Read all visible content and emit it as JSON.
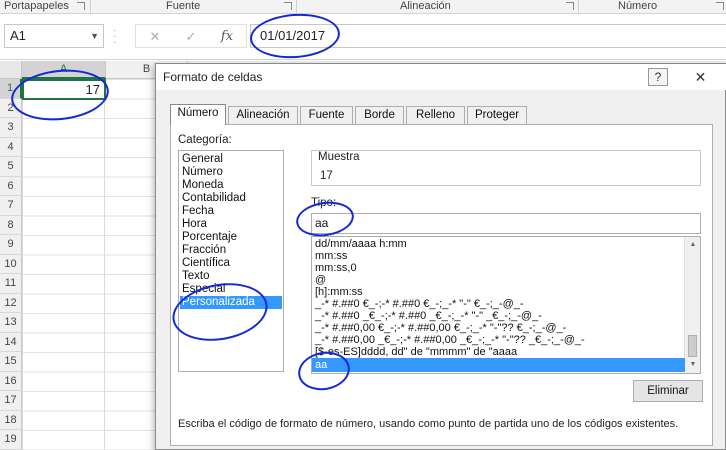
{
  "ribbon": {
    "groups": [
      "Portapapeles",
      "Fuente",
      "Alineación",
      "Número"
    ]
  },
  "formula_bar": {
    "name_box": "A1",
    "value": "01/01/2017",
    "fx_label": "fx"
  },
  "sheet": {
    "columns": [
      "A",
      "B"
    ],
    "rows": [
      "1",
      "2",
      "3",
      "4",
      "5",
      "6",
      "7",
      "8",
      "9",
      "10",
      "11",
      "12",
      "13",
      "14",
      "15",
      "16",
      "17",
      "18",
      "19"
    ],
    "active_cell_value": "17"
  },
  "dialog": {
    "title": "Formato de celdas",
    "help_label": "?",
    "tabs": [
      "Número",
      "Alineación",
      "Fuente",
      "Borde",
      "Relleno",
      "Proteger"
    ],
    "category_label": "Categoría:",
    "categories": [
      "General",
      "Número",
      "Moneda",
      "Contabilidad",
      "Fecha",
      "Hora",
      "Porcentaje",
      "Fracción",
      "Científica",
      "Texto",
      "Especial",
      "Personalizada"
    ],
    "sample_label": "Muestra",
    "sample_value": "17",
    "type_label": "Tipo:",
    "type_value": "aa",
    "formats": [
      "dd/mm/aaaa h:mm",
      "mm:ss",
      "mm:ss,0",
      "@",
      "[h]:mm:ss",
      "_-* #.##0 €_-;-* #.##0 €_-;_-* \"-\" €_-;_-@_-",
      "_-* #.##0 _€_-;-* #.##0 _€_-;_-* \"-\" _€_-;_-@_-",
      "_-* #.##0,00 €_-;-* #.##0,00 €_-;_-* \"-\"?? €_-;_-@_-",
      "_-* #.##0,00 _€_-;-* #.##0,00 _€_-;_-* \"-\"?? _€_-;_-@_-",
      "[$-es-ES]dddd, dd\" de \"mmmm\" de \"aaaa",
      "aa"
    ],
    "delete_button": "Eliminar",
    "description": "Escriba el código de formato de número, usando como punto de partida uno de los códigos existentes."
  },
  "colors": {
    "selection": "#3399ff",
    "excel_green": "#217346",
    "ink": "#1428d8"
  }
}
